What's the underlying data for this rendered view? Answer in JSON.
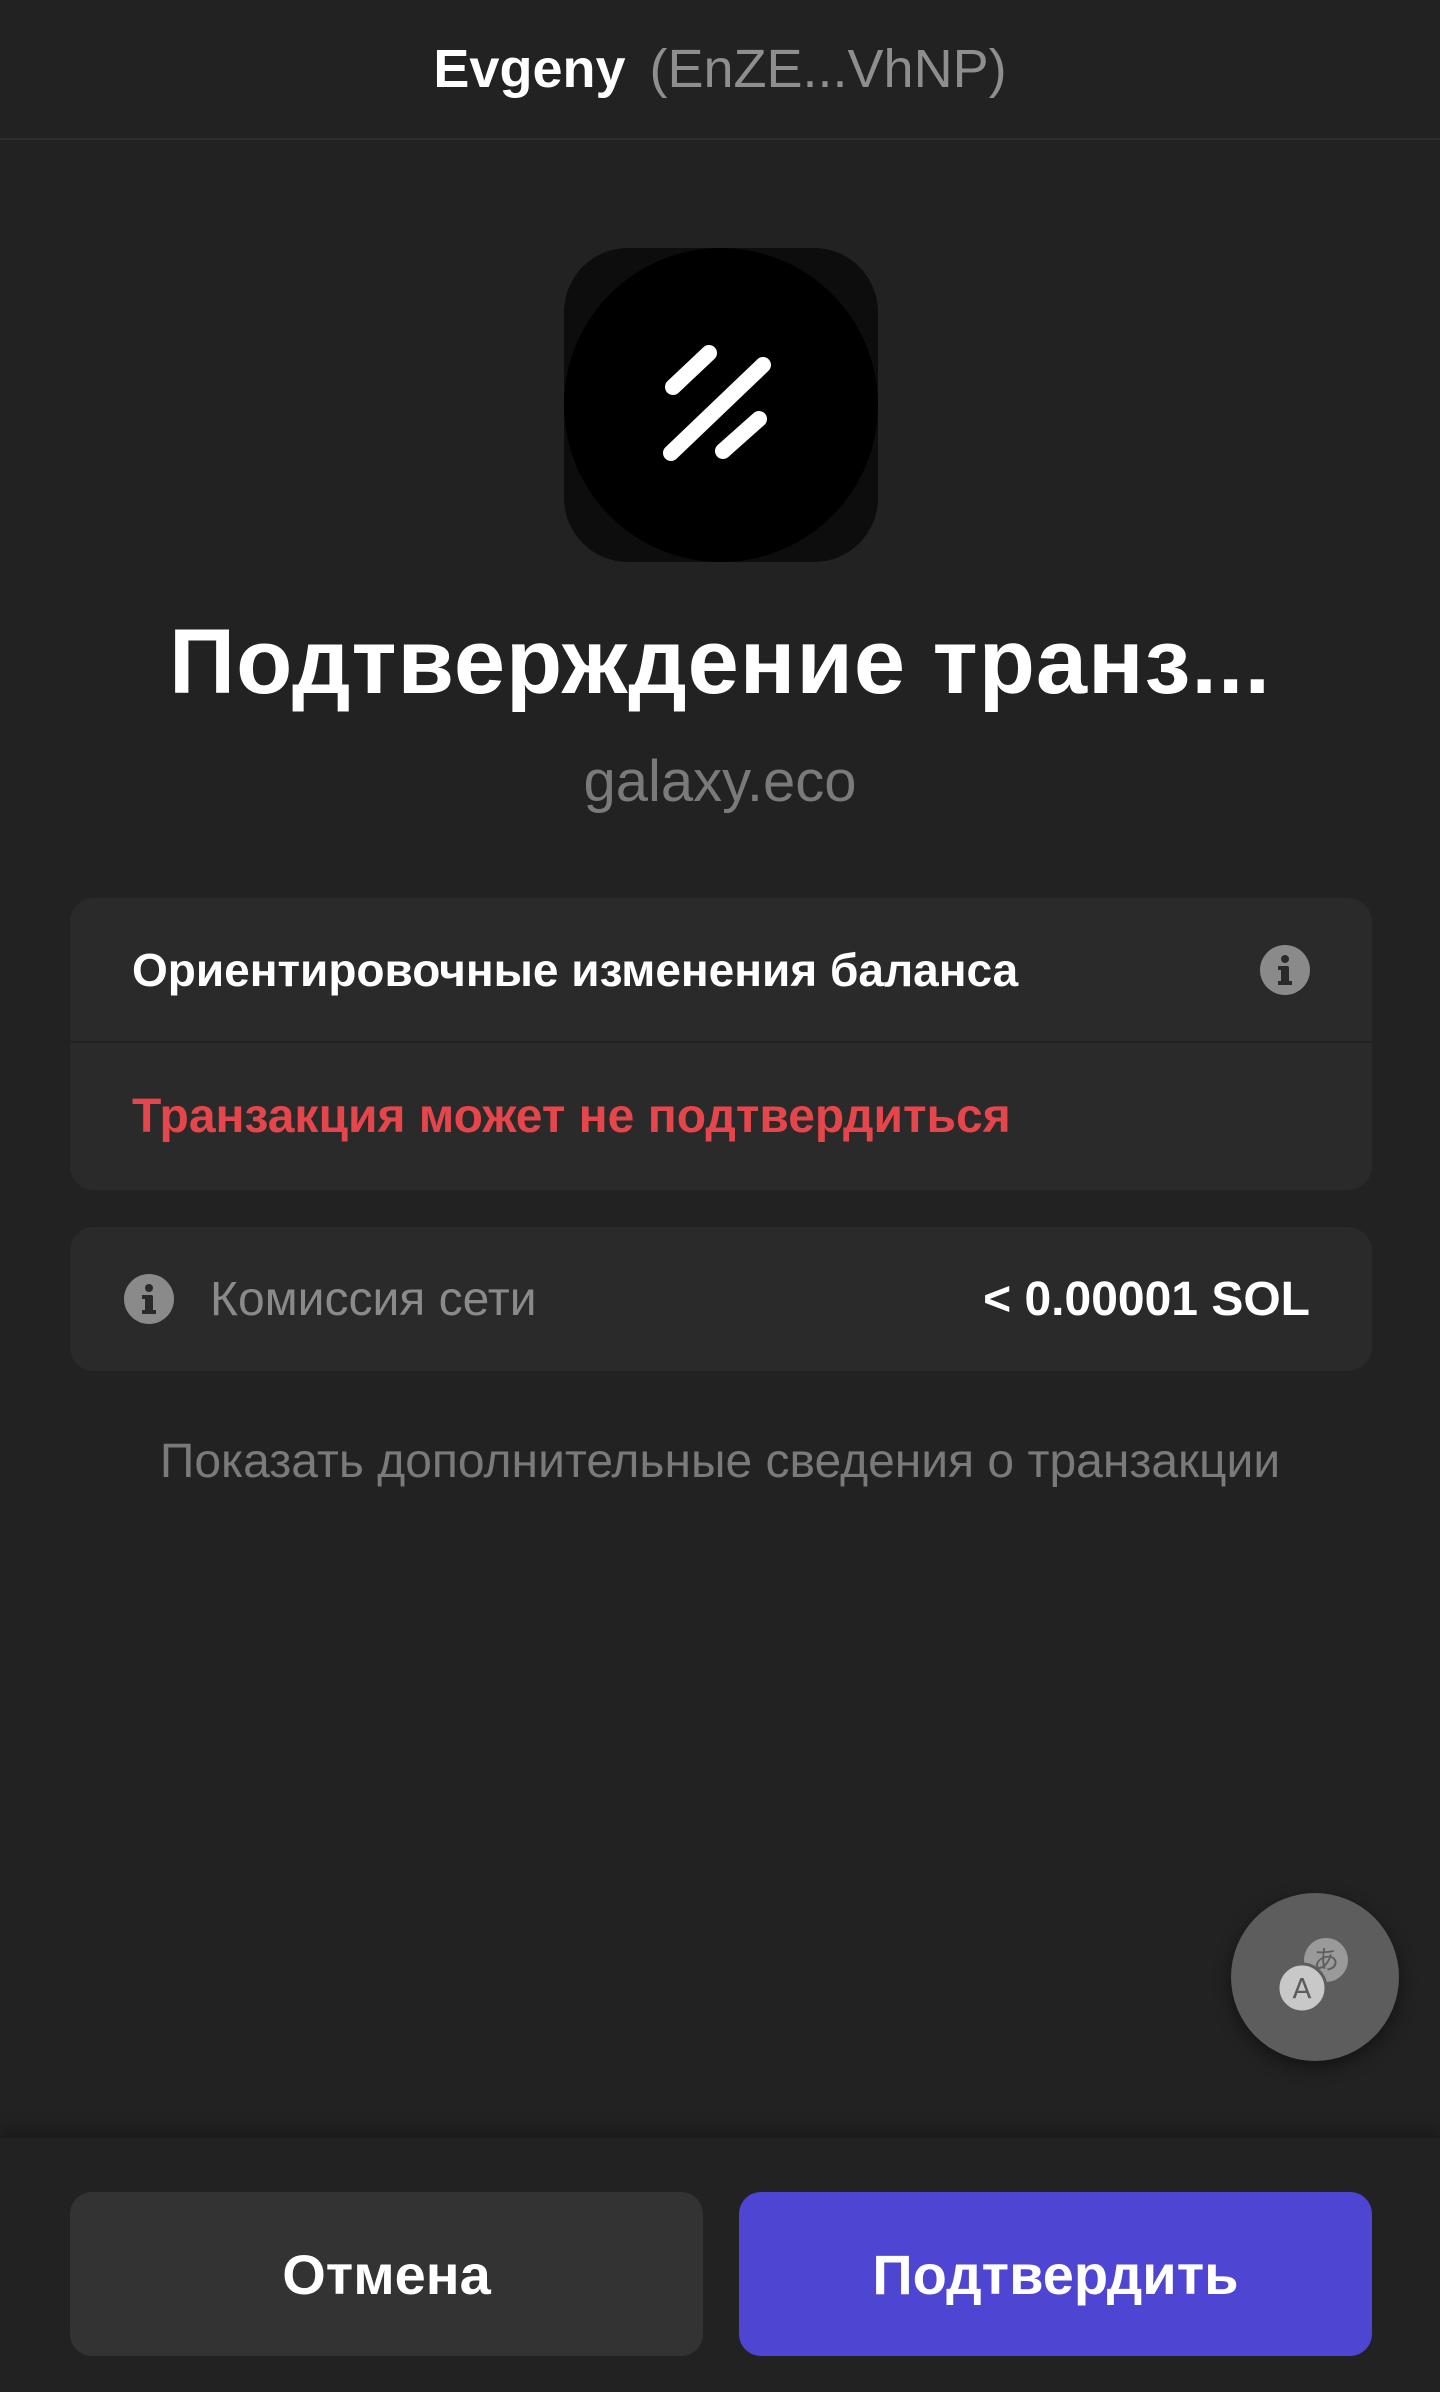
{
  "header": {
    "account_name": "Evgeny",
    "account_address": "(EnZE...VhNP)"
  },
  "app": {
    "icon": "slash-logo-icon"
  },
  "title": "Подтверждение транз...",
  "origin": "galaxy.eco",
  "balance_changes": {
    "label": "Ориентировочные изменения баланса",
    "warning": "Транзакция может не подтвердиться",
    "info_icon": "info-icon"
  },
  "network_fee": {
    "label": "Комиссия сети",
    "value": "< 0.00001 SOL",
    "info_icon": "info-icon"
  },
  "show_more_label": "Показать дополнительные сведения о транзакции",
  "fab": {
    "icon": "translate-icon"
  },
  "actions": {
    "cancel_label": "Отмена",
    "confirm_label": "Подтвердить"
  },
  "colors": {
    "background": "#222222",
    "card": "#2a2a2a",
    "warning": "#e5464b",
    "primary": "#4e45d2"
  }
}
